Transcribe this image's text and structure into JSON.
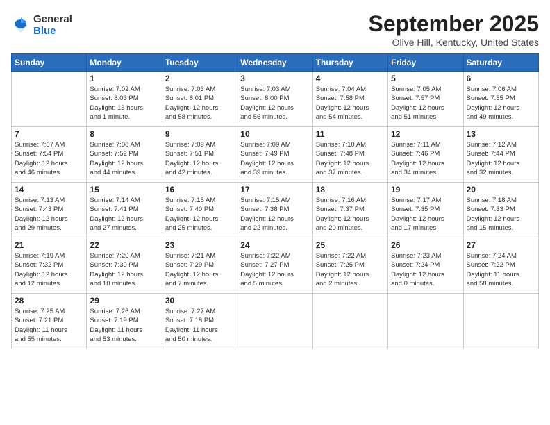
{
  "logo": {
    "general": "General",
    "blue": "Blue"
  },
  "title": "September 2025",
  "location": "Olive Hill, Kentucky, United States",
  "days_of_week": [
    "Sunday",
    "Monday",
    "Tuesday",
    "Wednesday",
    "Thursday",
    "Friday",
    "Saturday"
  ],
  "weeks": [
    [
      {
        "day": "",
        "info": ""
      },
      {
        "day": "1",
        "info": "Sunrise: 7:02 AM\nSunset: 8:03 PM\nDaylight: 13 hours\nand 1 minute."
      },
      {
        "day": "2",
        "info": "Sunrise: 7:03 AM\nSunset: 8:01 PM\nDaylight: 12 hours\nand 58 minutes."
      },
      {
        "day": "3",
        "info": "Sunrise: 7:03 AM\nSunset: 8:00 PM\nDaylight: 12 hours\nand 56 minutes."
      },
      {
        "day": "4",
        "info": "Sunrise: 7:04 AM\nSunset: 7:58 PM\nDaylight: 12 hours\nand 54 minutes."
      },
      {
        "day": "5",
        "info": "Sunrise: 7:05 AM\nSunset: 7:57 PM\nDaylight: 12 hours\nand 51 minutes."
      },
      {
        "day": "6",
        "info": "Sunrise: 7:06 AM\nSunset: 7:55 PM\nDaylight: 12 hours\nand 49 minutes."
      }
    ],
    [
      {
        "day": "7",
        "info": "Sunrise: 7:07 AM\nSunset: 7:54 PM\nDaylight: 12 hours\nand 46 minutes."
      },
      {
        "day": "8",
        "info": "Sunrise: 7:08 AM\nSunset: 7:52 PM\nDaylight: 12 hours\nand 44 minutes."
      },
      {
        "day": "9",
        "info": "Sunrise: 7:09 AM\nSunset: 7:51 PM\nDaylight: 12 hours\nand 42 minutes."
      },
      {
        "day": "10",
        "info": "Sunrise: 7:09 AM\nSunset: 7:49 PM\nDaylight: 12 hours\nand 39 minutes."
      },
      {
        "day": "11",
        "info": "Sunrise: 7:10 AM\nSunset: 7:48 PM\nDaylight: 12 hours\nand 37 minutes."
      },
      {
        "day": "12",
        "info": "Sunrise: 7:11 AM\nSunset: 7:46 PM\nDaylight: 12 hours\nand 34 minutes."
      },
      {
        "day": "13",
        "info": "Sunrise: 7:12 AM\nSunset: 7:44 PM\nDaylight: 12 hours\nand 32 minutes."
      }
    ],
    [
      {
        "day": "14",
        "info": "Sunrise: 7:13 AM\nSunset: 7:43 PM\nDaylight: 12 hours\nand 29 minutes."
      },
      {
        "day": "15",
        "info": "Sunrise: 7:14 AM\nSunset: 7:41 PM\nDaylight: 12 hours\nand 27 minutes."
      },
      {
        "day": "16",
        "info": "Sunrise: 7:15 AM\nSunset: 7:40 PM\nDaylight: 12 hours\nand 25 minutes."
      },
      {
        "day": "17",
        "info": "Sunrise: 7:15 AM\nSunset: 7:38 PM\nDaylight: 12 hours\nand 22 minutes."
      },
      {
        "day": "18",
        "info": "Sunrise: 7:16 AM\nSunset: 7:37 PM\nDaylight: 12 hours\nand 20 minutes."
      },
      {
        "day": "19",
        "info": "Sunrise: 7:17 AM\nSunset: 7:35 PM\nDaylight: 12 hours\nand 17 minutes."
      },
      {
        "day": "20",
        "info": "Sunrise: 7:18 AM\nSunset: 7:33 PM\nDaylight: 12 hours\nand 15 minutes."
      }
    ],
    [
      {
        "day": "21",
        "info": "Sunrise: 7:19 AM\nSunset: 7:32 PM\nDaylight: 12 hours\nand 12 minutes."
      },
      {
        "day": "22",
        "info": "Sunrise: 7:20 AM\nSunset: 7:30 PM\nDaylight: 12 hours\nand 10 minutes."
      },
      {
        "day": "23",
        "info": "Sunrise: 7:21 AM\nSunset: 7:29 PM\nDaylight: 12 hours\nand 7 minutes."
      },
      {
        "day": "24",
        "info": "Sunrise: 7:22 AM\nSunset: 7:27 PM\nDaylight: 12 hours\nand 5 minutes."
      },
      {
        "day": "25",
        "info": "Sunrise: 7:22 AM\nSunset: 7:25 PM\nDaylight: 12 hours\nand 2 minutes."
      },
      {
        "day": "26",
        "info": "Sunrise: 7:23 AM\nSunset: 7:24 PM\nDaylight: 12 hours\nand 0 minutes."
      },
      {
        "day": "27",
        "info": "Sunrise: 7:24 AM\nSunset: 7:22 PM\nDaylight: 11 hours\nand 58 minutes."
      }
    ],
    [
      {
        "day": "28",
        "info": "Sunrise: 7:25 AM\nSunset: 7:21 PM\nDaylight: 11 hours\nand 55 minutes."
      },
      {
        "day": "29",
        "info": "Sunrise: 7:26 AM\nSunset: 7:19 PM\nDaylight: 11 hours\nand 53 minutes."
      },
      {
        "day": "30",
        "info": "Sunrise: 7:27 AM\nSunset: 7:18 PM\nDaylight: 11 hours\nand 50 minutes."
      },
      {
        "day": "",
        "info": ""
      },
      {
        "day": "",
        "info": ""
      },
      {
        "day": "",
        "info": ""
      },
      {
        "day": "",
        "info": ""
      }
    ]
  ]
}
